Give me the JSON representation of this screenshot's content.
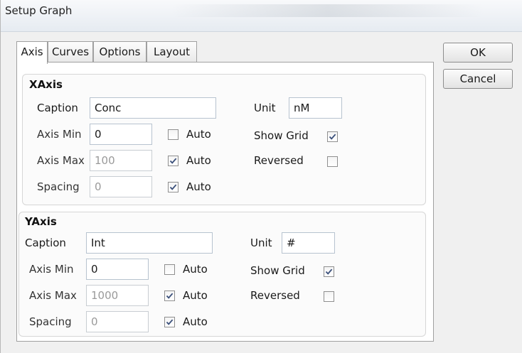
{
  "window": {
    "title": "Setup Graph"
  },
  "tabs": [
    "Axis",
    "Curves",
    "Options",
    "Layout"
  ],
  "buttons": {
    "ok": "OK",
    "cancel": "Cancel"
  },
  "xaxis": {
    "title": "XAxis",
    "caption_label": "Caption",
    "caption_value": "Conc",
    "unit_label": "Unit",
    "unit_value": "nM",
    "min_label": "Axis Min",
    "min_value": "0",
    "min_auto": false,
    "max_label": "Axis Max",
    "max_value": "100",
    "max_auto": true,
    "spacing_label": "Spacing",
    "spacing_value": "0",
    "spacing_auto": true,
    "auto_label": "Auto",
    "grid_label": "Show Grid",
    "grid_checked": true,
    "reversed_label": "Reversed",
    "reversed_checked": false
  },
  "yaxis": {
    "title": "YAxis",
    "caption_label": "Caption",
    "caption_value": "Int",
    "unit_label": "Unit",
    "unit_value": "#",
    "min_label": "Axis Min",
    "min_value": "0",
    "min_auto": false,
    "max_label": "Axis Max",
    "max_value": "1000",
    "max_auto": true,
    "spacing_label": "Spacing",
    "spacing_value": "0",
    "spacing_auto": true,
    "auto_label": "Auto",
    "grid_label": "Show Grid",
    "grid_checked": true,
    "reversed_label": "Reversed",
    "reversed_checked": false
  }
}
